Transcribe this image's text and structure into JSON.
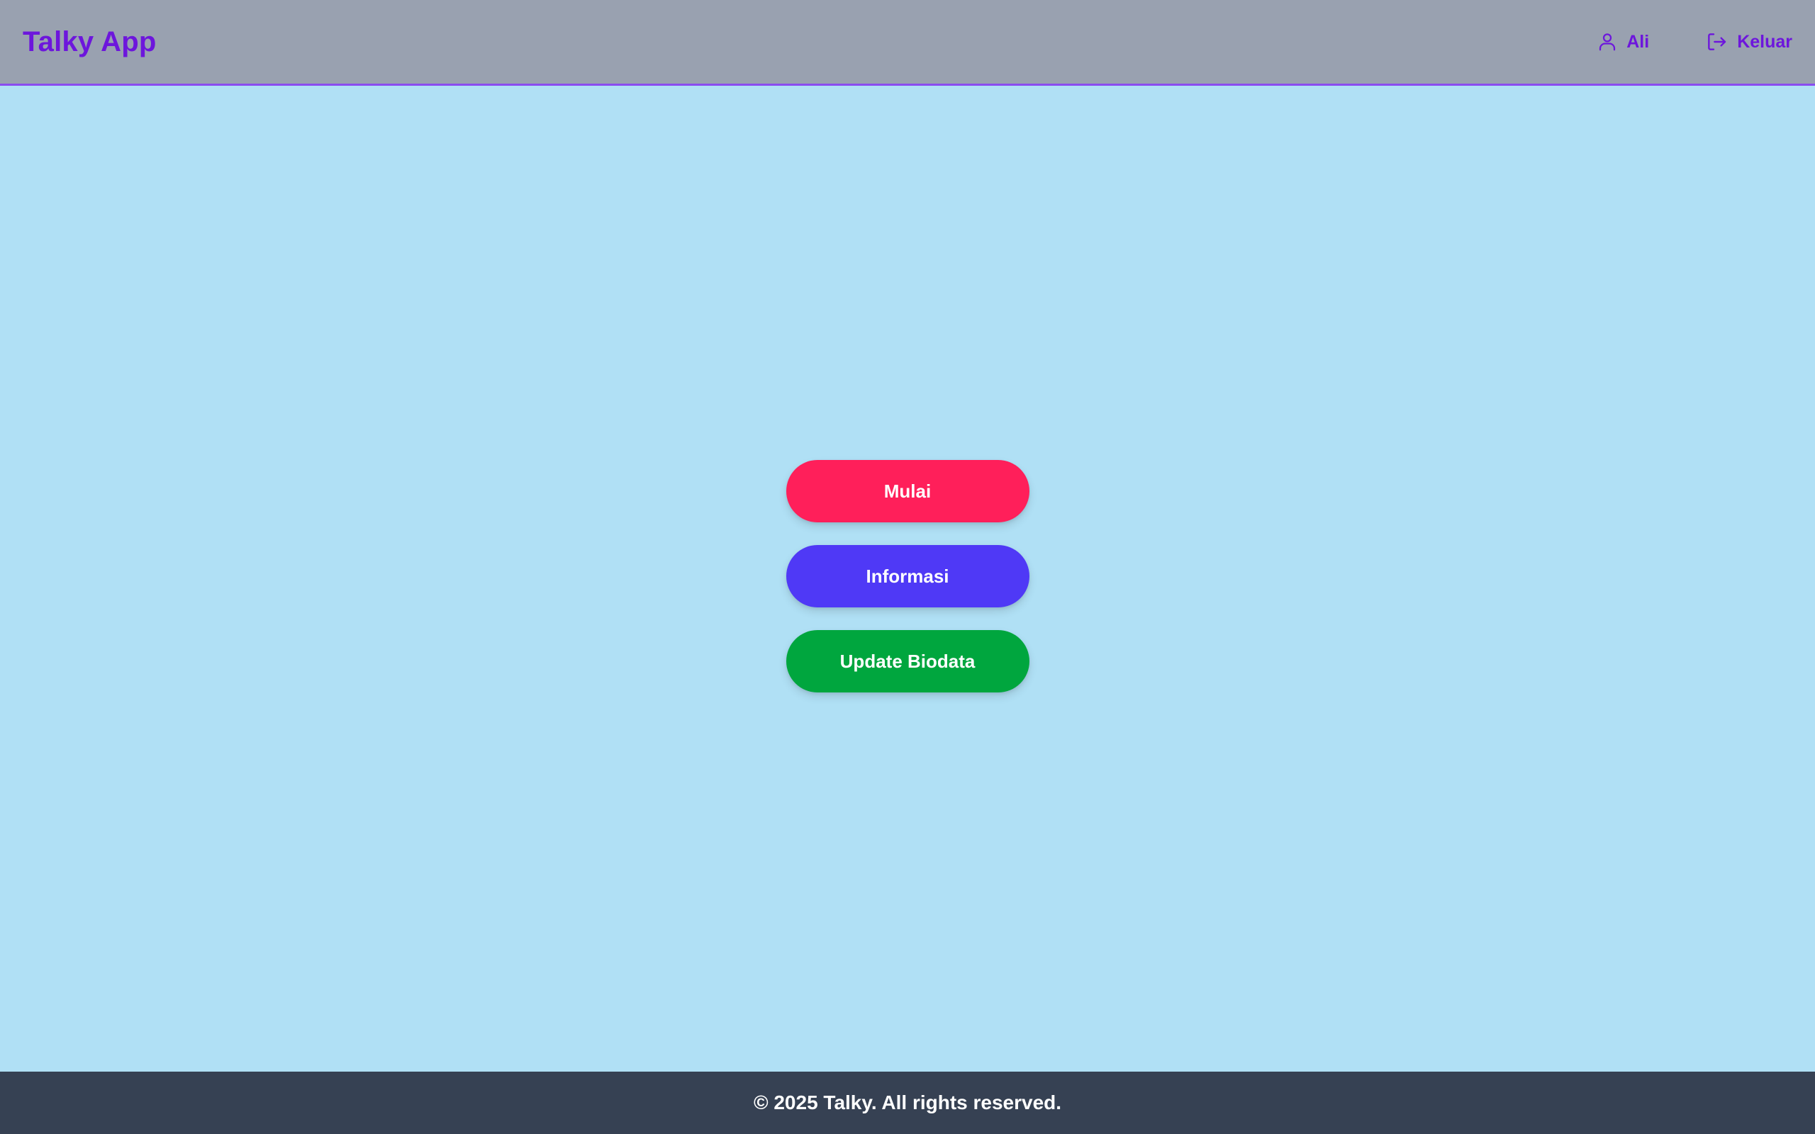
{
  "header": {
    "brand": "Talky App",
    "user_label": "Ali",
    "user_icon": "user-icon",
    "logout_label": "Keluar",
    "logout_icon": "logout-icon"
  },
  "main": {
    "buttons": [
      {
        "label": "Mulai",
        "color": "#ff1f5a"
      },
      {
        "label": "Informasi",
        "color": "#4f39f6"
      },
      {
        "label": "Update Biodata",
        "color": "#00a63e"
      }
    ]
  },
  "footer": {
    "text": "© 2025 Talky. All rights reserved."
  },
  "colors": {
    "accent": "#6d16dc",
    "header_bg": "#99a1b0",
    "page_bg": "#b0e0f5",
    "footer_bg": "#364153"
  }
}
